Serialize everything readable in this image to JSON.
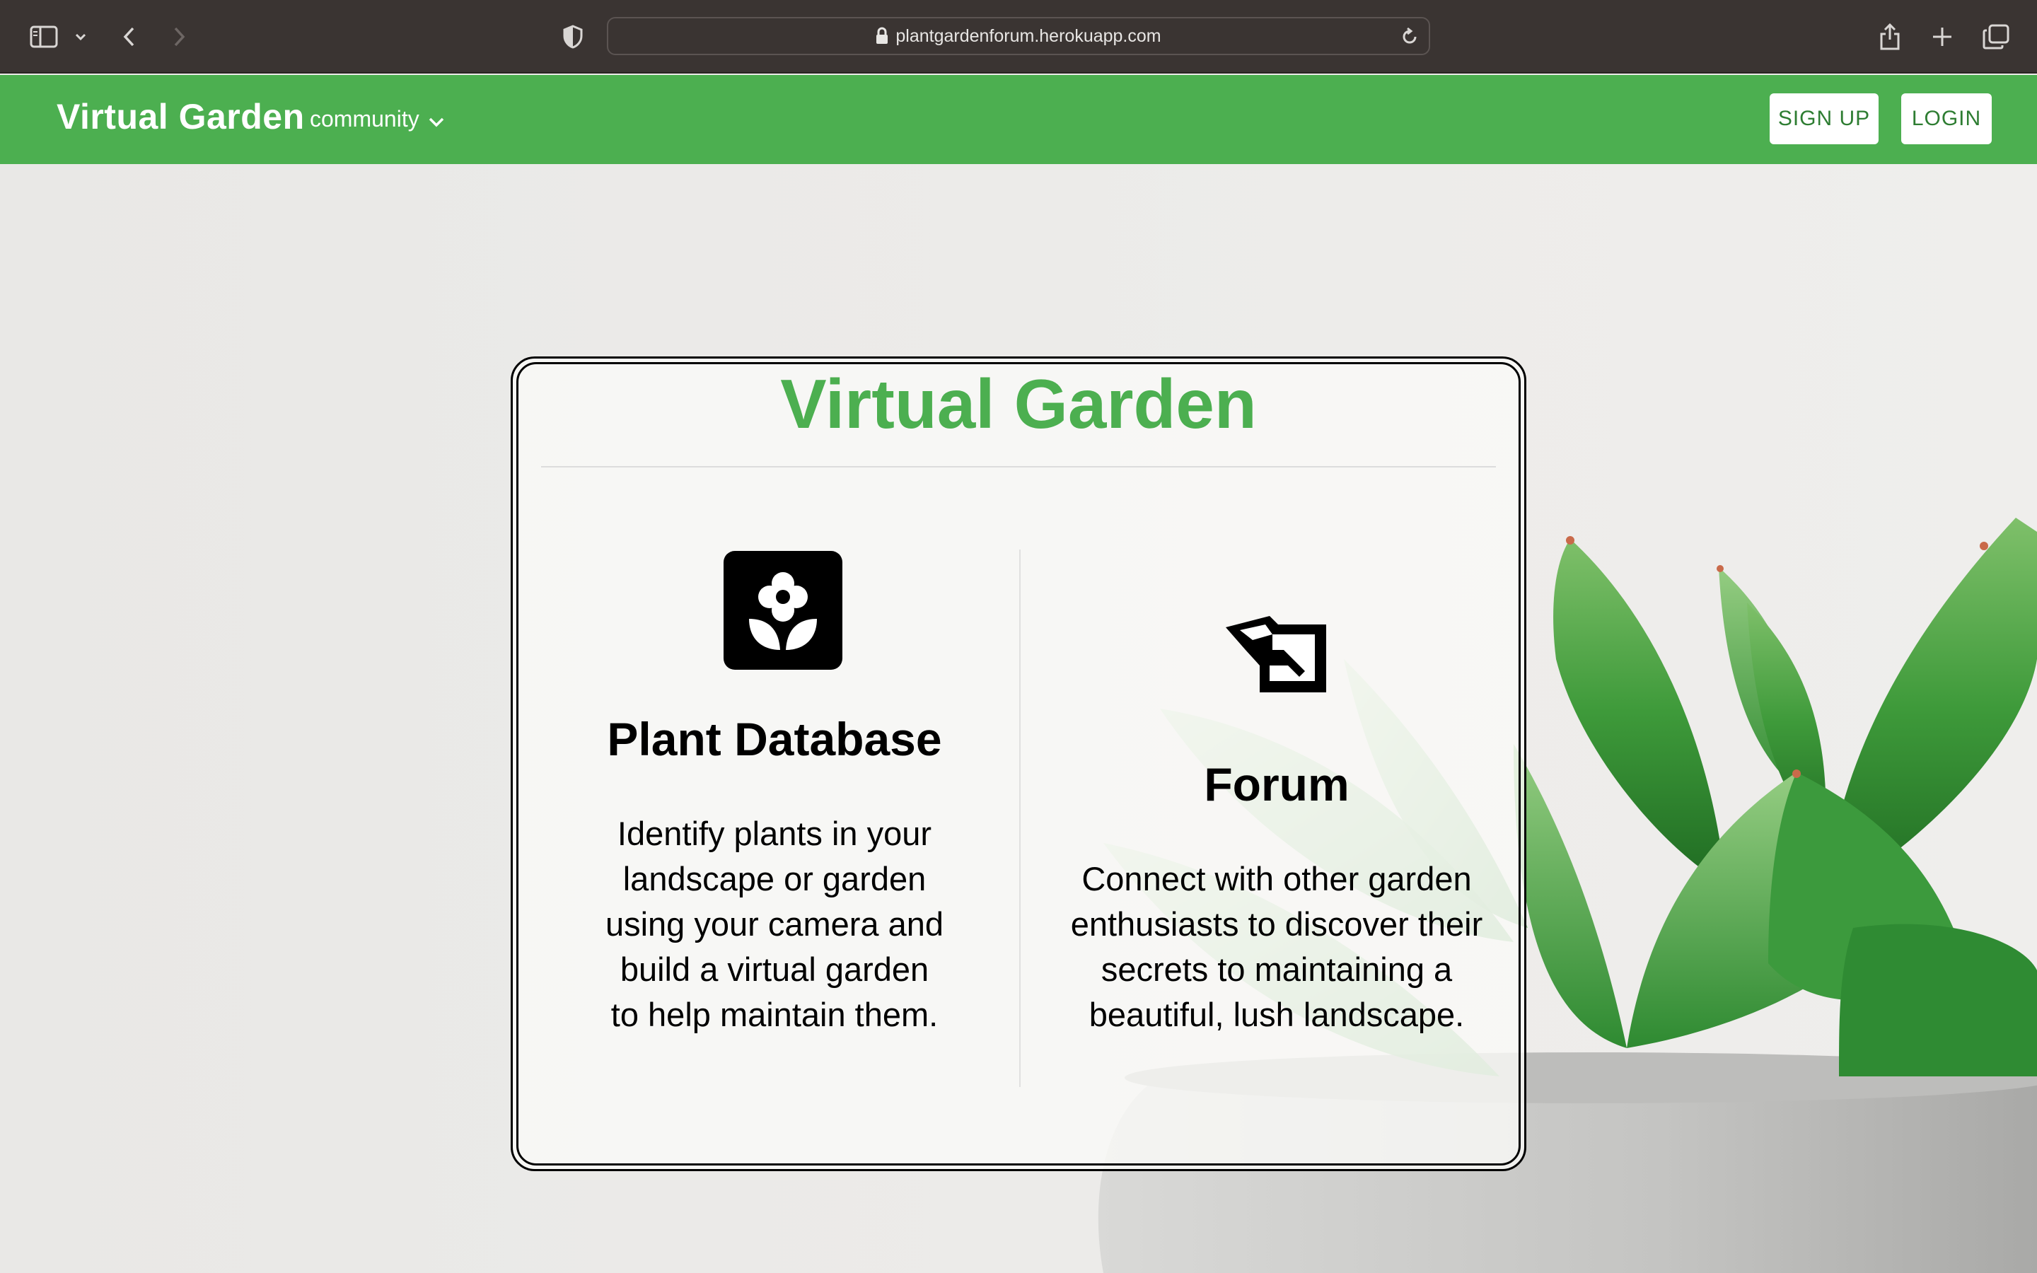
{
  "browser": {
    "url": "plantgardenforum.herokuapp.com",
    "icons": [
      "sidebar-icon",
      "chevron-down-icon",
      "back-icon",
      "forward-icon",
      "shield-icon",
      "lock-icon",
      "reload-icon",
      "share-icon",
      "plus-icon",
      "tabs-icon"
    ]
  },
  "navbar": {
    "brand": "Virtual Garden",
    "community_label": "community",
    "signup_label": "SIGN UP",
    "login_label": "LOGIN",
    "color": "#4caf50"
  },
  "card": {
    "title": "Virtual Garden",
    "left": {
      "icon": "flower-icon",
      "heading": "Plant Database",
      "text": "Identify plants in your landscape or garden using your camera and build a virtual garden to help maintain them."
    },
    "right": {
      "icon": "watering-can-icon",
      "heading": "Forum",
      "text": "Connect with other garden enthusiasts to discover their secrets to maintaining a beautiful, lush landscape."
    }
  }
}
